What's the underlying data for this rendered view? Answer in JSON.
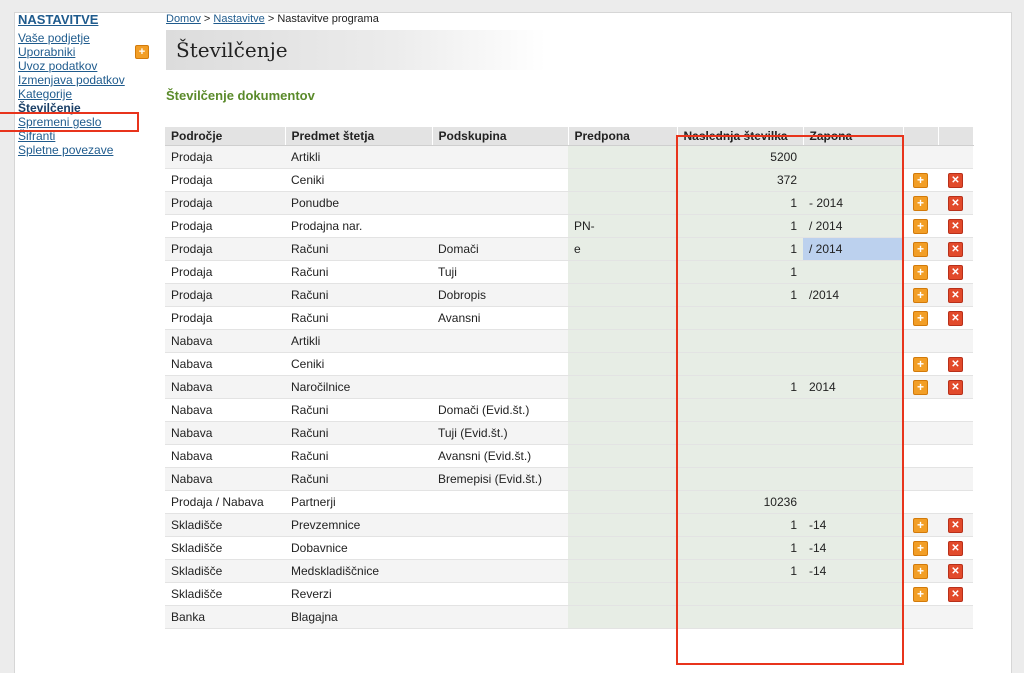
{
  "sidebar": {
    "title": "NASTAVITVE",
    "items": [
      {
        "label": "Vaše podjetje"
      },
      {
        "label": "Uporabniki",
        "has_add": true
      },
      {
        "label": "Uvoz podatkov"
      },
      {
        "label": "Izmenjava podatkov"
      },
      {
        "label": "Kategorije"
      },
      {
        "label": "Številčenje",
        "active": true
      },
      {
        "label": "Spremeni geslo"
      },
      {
        "label": "Šifranti"
      },
      {
        "label": "Spletne povezave"
      }
    ]
  },
  "breadcrumb": {
    "home": "Domov",
    "sep1": ">",
    "settings": "Nastavitve",
    "sep2": ">",
    "current": "Nastavitve programa"
  },
  "page_title": "Številčenje",
  "section_title": "Številčenje dokumentov",
  "table": {
    "headers": [
      "Področje",
      "Predmet štetja",
      "Podskupina",
      "Predpona",
      "Naslednja številka",
      "Zapona",
      "",
      ""
    ],
    "rows": [
      {
        "area": "Prodaja",
        "subject": "Artikli",
        "subgroup": "",
        "prefix": "",
        "next": "5200",
        "suffix": "",
        "actions": false
      },
      {
        "area": "Prodaja",
        "subject": "Ceniki",
        "subgroup": "",
        "prefix": "",
        "next": "372",
        "suffix": "",
        "actions": true
      },
      {
        "area": "Prodaja",
        "subject": "Ponudbe",
        "subgroup": "",
        "prefix": "",
        "next": "1",
        "suffix": "- 2014",
        "actions": true
      },
      {
        "area": "Prodaja",
        "subject": "Prodajna nar.",
        "subgroup": "",
        "prefix": "PN-",
        "next": "1",
        "suffix": "/ 2014",
        "actions": true
      },
      {
        "area": "Prodaja",
        "subject": "Računi",
        "subgroup": "Domači",
        "prefix": "e",
        "next": "1",
        "suffix": "/ 2014",
        "actions": true,
        "selected": true
      },
      {
        "area": "Prodaja",
        "subject": "Računi",
        "subgroup": "Tuji",
        "prefix": "",
        "next": "1",
        "suffix": "",
        "actions": true
      },
      {
        "area": "Prodaja",
        "subject": "Računi",
        "subgroup": "Dobropis",
        "prefix": "",
        "next": "1",
        "suffix": "/2014",
        "actions": true
      },
      {
        "area": "Prodaja",
        "subject": "Računi",
        "subgroup": "Avansni",
        "prefix": "",
        "next": "",
        "suffix": "",
        "actions": true
      },
      {
        "area": "Nabava",
        "subject": "Artikli",
        "subgroup": "",
        "prefix": "",
        "next": "",
        "suffix": "",
        "actions": false
      },
      {
        "area": "Nabava",
        "subject": "Ceniki",
        "subgroup": "",
        "prefix": "",
        "next": "",
        "suffix": "",
        "actions": true
      },
      {
        "area": "Nabava",
        "subject": "Naročilnice",
        "subgroup": "",
        "prefix": "",
        "next": "1",
        "suffix": "2014",
        "actions": true
      },
      {
        "area": "Nabava",
        "subject": "Računi",
        "subgroup": "Domači (Evid.št.)",
        "prefix": "",
        "next": "",
        "suffix": "",
        "actions": false
      },
      {
        "area": "Nabava",
        "subject": "Računi",
        "subgroup": "Tuji (Evid.št.)",
        "prefix": "",
        "next": "",
        "suffix": "",
        "actions": false
      },
      {
        "area": "Nabava",
        "subject": "Računi",
        "subgroup": "Avansni (Evid.št.)",
        "prefix": "",
        "next": "",
        "suffix": "",
        "actions": false
      },
      {
        "area": "Nabava",
        "subject": "Računi",
        "subgroup": "Bremepisi (Evid.št.)",
        "prefix": "",
        "next": "",
        "suffix": "",
        "actions": false
      },
      {
        "area": "Prodaja / Nabava",
        "subject": "Partnerji",
        "subgroup": "",
        "prefix": "",
        "next": "10236",
        "suffix": "",
        "actions": false
      },
      {
        "area": "Skladišče",
        "subject": "Prevzemnice",
        "subgroup": "",
        "prefix": "",
        "next": "1",
        "suffix": "-14",
        "actions": true
      },
      {
        "area": "Skladišče",
        "subject": "Dobavnice",
        "subgroup": "",
        "prefix": "",
        "next": "1",
        "suffix": "-14",
        "actions": true
      },
      {
        "area": "Skladišče",
        "subject": "Medskladiščnice",
        "subgroup": "",
        "prefix": "",
        "next": "1",
        "suffix": "-14",
        "actions": true
      },
      {
        "area": "Skladišče",
        "subject": "Reverzi",
        "subgroup": "",
        "prefix": "",
        "next": "",
        "suffix": "",
        "actions": true
      },
      {
        "area": "Banka",
        "subject": "Blagajna",
        "subgroup": "",
        "prefix": "",
        "next": "",
        "suffix": "",
        "actions": false
      }
    ]
  },
  "icons": {
    "add": "plus-icon",
    "delete": "close-icon"
  },
  "colors": {
    "link": "#1f5b8d",
    "section": "#5a8a2a",
    "highlight": "#e8341c",
    "add": "#f29e26",
    "delete": "#e24a2b",
    "selected_cell": "#bcd1ee"
  }
}
